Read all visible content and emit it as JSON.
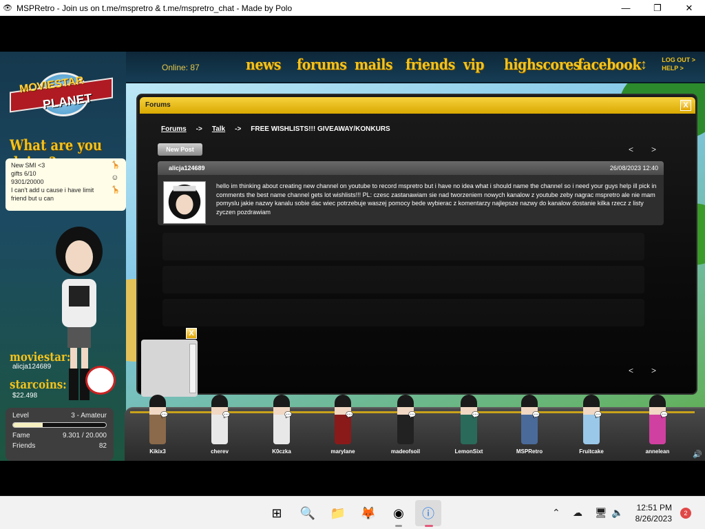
{
  "window": {
    "title": "MSPRetro - Join us on t.me/mspretro & t.me/mspretro_chat - Made by Polo",
    "app_icon": "mspretro-icon",
    "minimize": "—",
    "maximize": "❐",
    "close": "✕"
  },
  "nav": {
    "online": "Online: 87",
    "items": [
      "news",
      "forums",
      "mails",
      "friends",
      "vip",
      "highscores",
      "facebook"
    ],
    "scroll_arrows": "↕",
    "logout": "LOG OUT >",
    "help": "HELP >"
  },
  "sidebar": {
    "logo_line1": "MOVIESTAR",
    "logo_line2": "PLANET",
    "doing_heading": "What are you doing?",
    "status_lines": [
      "New SMI <3",
      "gifts 6/10",
      "9301/20000",
      "I can't add u cause i have limit",
      "friend but u can"
    ],
    "moviestar_heading": "moviestar:",
    "username": "alicja124689",
    "starcoins_heading": "starcoins:",
    "starcoins": "$22.498",
    "level_label": "Level",
    "level_value": "3 - Amateur",
    "level_progress": 0.32,
    "fame_label": "Fame",
    "fame_value": "9.301 / 20.000",
    "friends_label": "Friends",
    "friends_value": "82"
  },
  "forum": {
    "title": "Forums",
    "close": "X",
    "breadcrumb": {
      "root": "Forums",
      "sep": "->",
      "section": "Talk",
      "topic": "FREE WISHLISTS!!! GIVEAWAY/KONKURS"
    },
    "new_post": "New Post",
    "pager_prev": "<",
    "pager_next": ">",
    "post": {
      "author": "alicja124689",
      "date": "26/08/2023 12:40",
      "body": "hello im thinking about creating new channel on youtube to record mspretro but i have no idea what i should name the channel so i need your guys help ill pick in comments the best name channel gets lot wishlists!!! PL: czesc zastanawiam sie nad tworzeniem nowych kanalow z youtube zeby nagrac mspretro ale nie mam pomyslu jakie nazwy kanalu sobie dac wiec potrzebuje waszej pomocy bede wybierac z komentarzy najlepsze nazwy do kanalow dostanie kilka rzecz z listy zyczen pozdrawiam"
    }
  },
  "chat": {
    "close": "X"
  },
  "room_avatars": [
    {
      "name": "Kikix3",
      "color": "#8a6a4a"
    },
    {
      "name": "cherev",
      "color": "#e8e8e8"
    },
    {
      "name": "K0czka",
      "color": "#e8e8e8"
    },
    {
      "name": "marylane",
      "color": "#8a1a1a"
    },
    {
      "name": "madeofsoil",
      "color": "#222222"
    },
    {
      "name": "LemonSixt",
      "color": "#2a6a5a"
    },
    {
      "name": "MSPRetro",
      "color": "#4a6a9a"
    },
    {
      "name": "Fruitcake",
      "color": "#9ac8e8"
    },
    {
      "name": "annelean",
      "color": "#d040a0"
    }
  ],
  "taskbar": {
    "time": "12:51 PM",
    "date": "8/26/2023",
    "notifications": "2"
  }
}
